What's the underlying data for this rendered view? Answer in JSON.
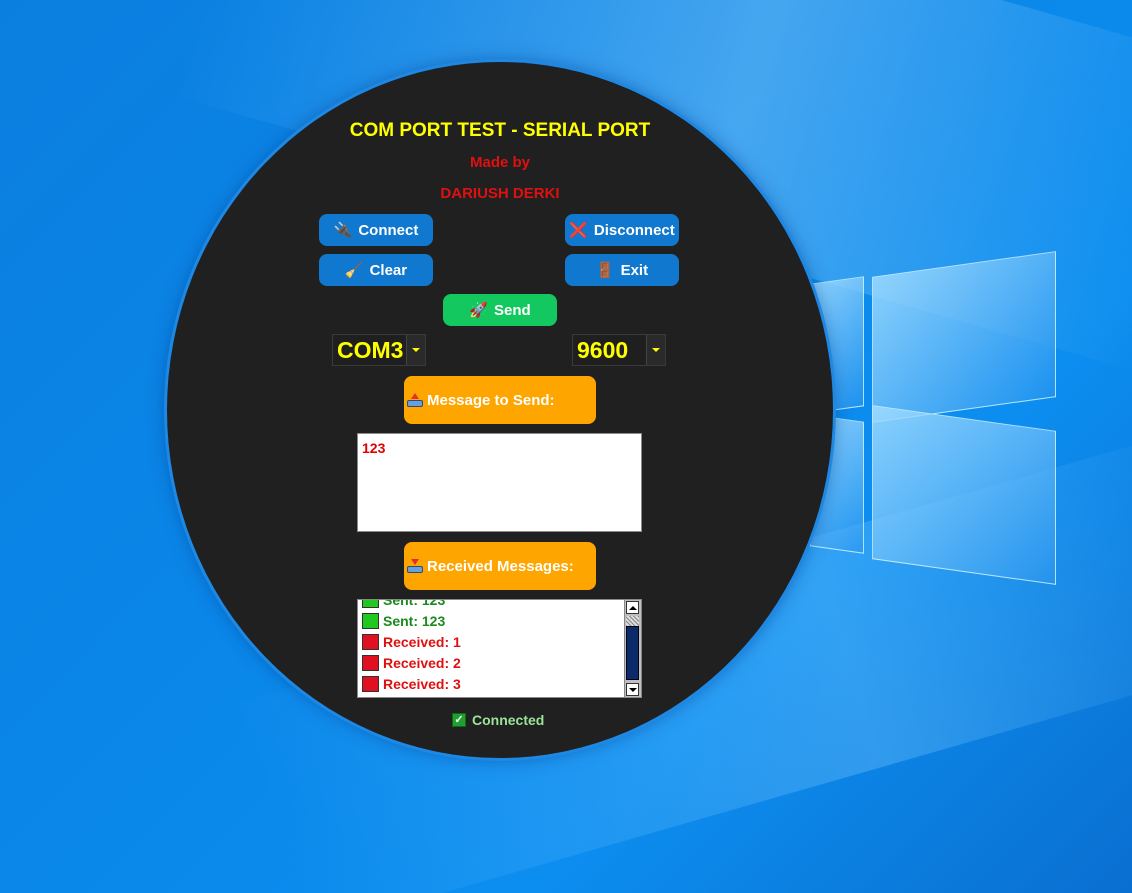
{
  "app": {
    "title": "COM PORT TEST - SERIAL PORT",
    "made_by": "Made by",
    "author": "DARIUSH DERKI"
  },
  "buttons": {
    "connect": "Connect",
    "disconnect": "Disconnect",
    "clear": "Clear",
    "exit": "Exit",
    "send": "Send"
  },
  "icons": {
    "connect": "plug-icon",
    "disconnect": "cross-mark-icon",
    "clear": "broom-icon",
    "exit": "door-icon",
    "send": "rocket-icon",
    "message_header": "outbox-tray-icon",
    "received_header": "inbox-tray-icon",
    "status": "check-icon"
  },
  "port_select": {
    "value": "COM3"
  },
  "baud_select": {
    "value": "9600"
  },
  "message_header": "Message to Send:",
  "message_input": {
    "value": "123"
  },
  "received_header": "Received Messages:",
  "received_list": [
    {
      "kind": "sent",
      "text": "Sent: 123"
    },
    {
      "kind": "sent",
      "text": "Sent: 123"
    },
    {
      "kind": "received",
      "text": "Received: 1"
    },
    {
      "kind": "received",
      "text": "Received: 2"
    },
    {
      "kind": "received",
      "text": "Received: 3"
    }
  ],
  "status": {
    "text": "Connected",
    "checked": true
  },
  "colors": {
    "panel": "#202020",
    "title": "#ffff00",
    "accent_red": "#e01010",
    "button_blue": "#1178cf",
    "button_green": "#13c85f",
    "header_orange": "#ffa500",
    "sent_marker": "#20c820",
    "received_marker": "#e01020"
  }
}
